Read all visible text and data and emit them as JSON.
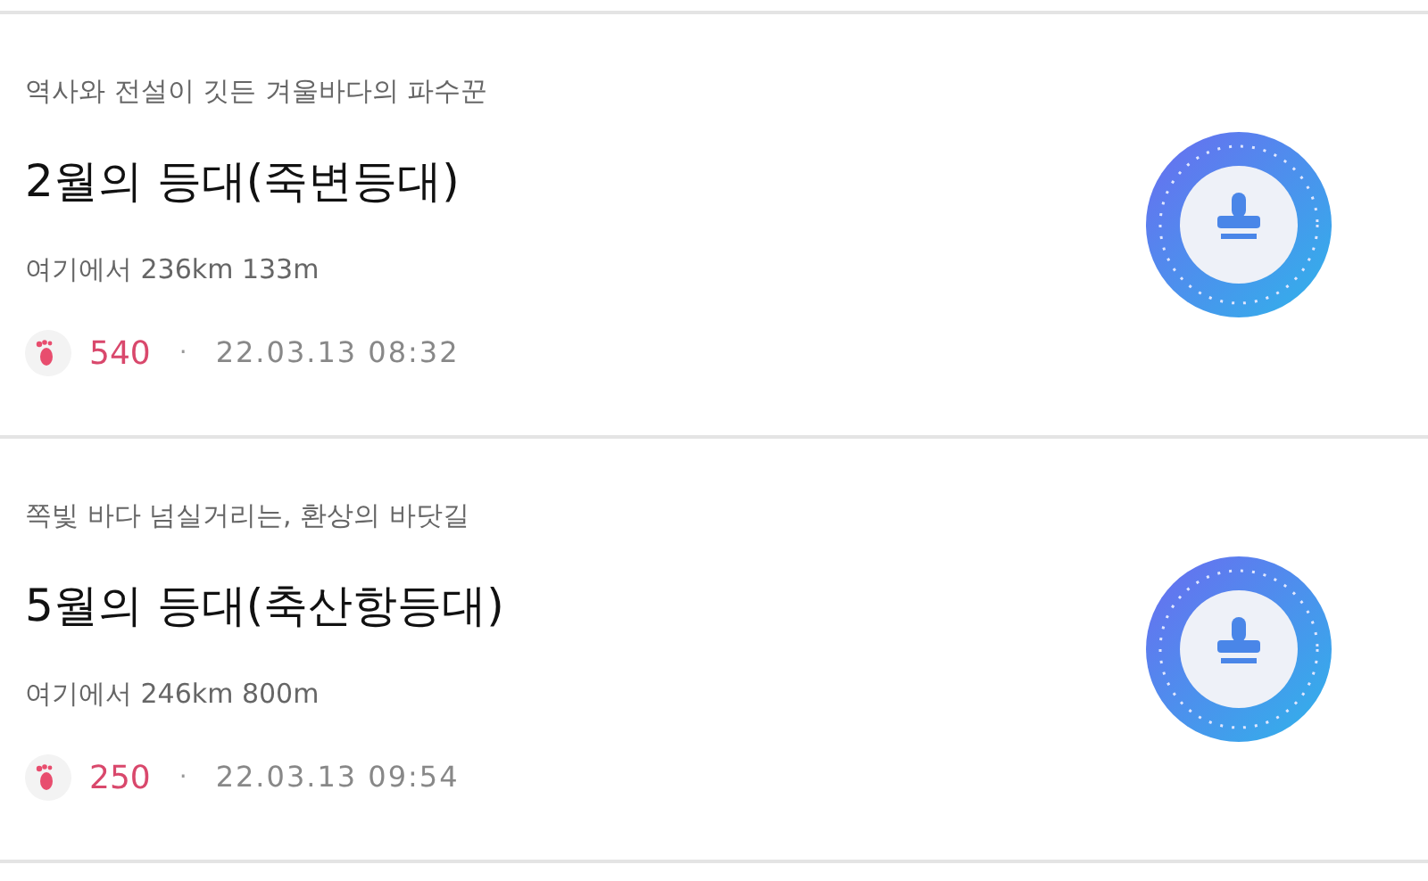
{
  "items": [
    {
      "subtitle": "역사와 전설이 깃든 겨울바다의 파수꾼",
      "title": "2월의 등대(죽변등대)",
      "distance": "여기에서 236km 133m",
      "steps": "540",
      "separator": "·",
      "datetime": "22.03.13 08:32"
    },
    {
      "subtitle": "쪽빛 바다 넘실거리는, 환상의 바닷길",
      "title": "5월의 등대(축산항등대)",
      "distance": "여기에서 246km 800m",
      "steps": "250",
      "separator": "·",
      "datetime": "22.03.13 09:54"
    }
  ]
}
